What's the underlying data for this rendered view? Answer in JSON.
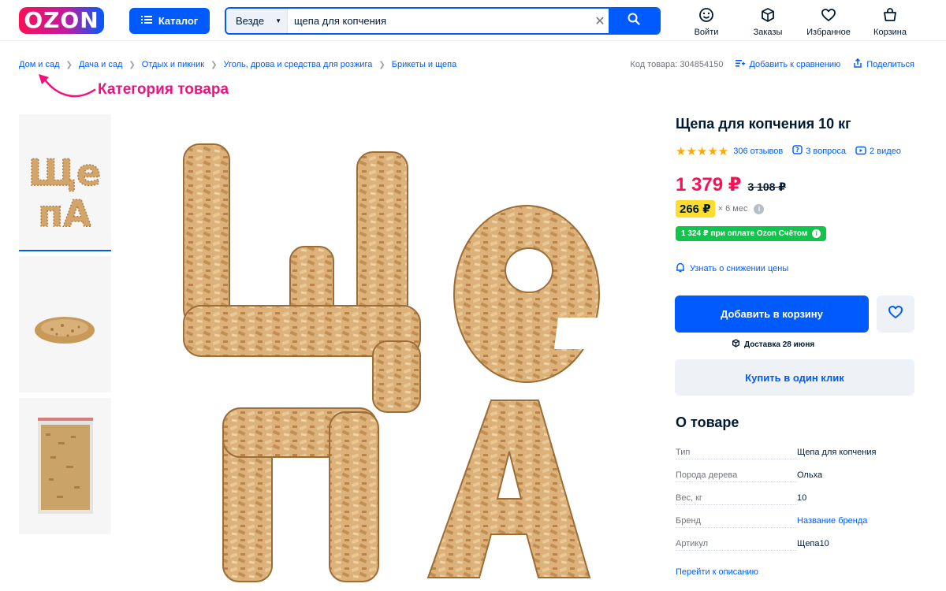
{
  "header": {
    "logo": "OZON",
    "catalog_label": "Каталог",
    "search": {
      "scope": "Везде",
      "query": "щепа для копчения"
    },
    "nav": [
      {
        "label": "Войти",
        "icon": "smile-icon"
      },
      {
        "label": "Заказы",
        "icon": "box-icon"
      },
      {
        "label": "Избранное",
        "icon": "heart-icon"
      },
      {
        "label": "Корзина",
        "icon": "cart-icon"
      }
    ]
  },
  "breadcrumbs": [
    "Дом и сад",
    "Дача и сад",
    "Отдых и пикник",
    "Уголь, дрова и средства для розжига",
    "Брикеты и щепа"
  ],
  "toolbar": {
    "sku": "Код товара: 304854150",
    "compare": "Добавить к сравнению",
    "share": "Поделиться"
  },
  "annotation": {
    "text": "Категория товара",
    "color": "#f1117e"
  },
  "gallery": {
    "main_letters": [
      "Ще",
      "пА"
    ]
  },
  "product": {
    "title": "Щепа для копчения 10 кг",
    "rating_stars": 5,
    "reviews": "306 отзывов",
    "questions": "3 вопроса",
    "videos": "2 видео",
    "price": "1 379 ₽",
    "old_price": "3 108 ₽",
    "installment_price": "266 ₽",
    "installment_term": "× 6 мес",
    "card_offer": "1 324 ₽ при оплате Ozon Счётом",
    "notify": "Узнать о снижении цены",
    "add_to_cart": "Добавить в корзину",
    "delivery": "Доставка 28 июня",
    "buy_one_click": "Купить в один клик"
  },
  "about": {
    "title": "О товаре",
    "specs": [
      {
        "key": "Тип",
        "value": "Щепа для копчения",
        "link": false
      },
      {
        "key": "Порода дерева",
        "value": "Ольха",
        "link": false
      },
      {
        "key": "Вес, кг",
        "value": "10",
        "link": false
      },
      {
        "key": "Бренд",
        "value": "Название бренда",
        "link": true
      },
      {
        "key": "Артикул",
        "value": "Щепа10",
        "link": false
      }
    ],
    "description_link": "Перейти к описанию"
  },
  "colors": {
    "accent": "#005bff",
    "price": "#f91155",
    "green": "#10c44c",
    "yellow": "#ffdd2d",
    "star": "#ffa800"
  }
}
